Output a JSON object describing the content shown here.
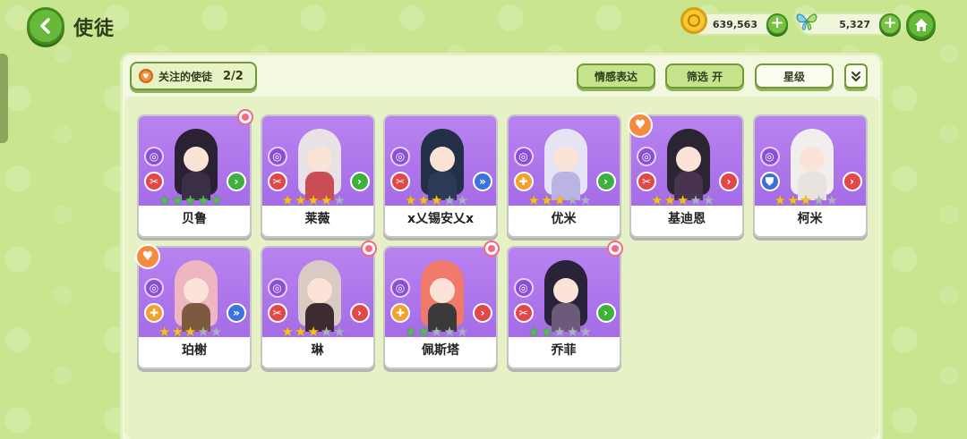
{
  "header": {
    "title": "使徒",
    "coin_amount": "639,563",
    "gem_amount": "5,327"
  },
  "toolbar": {
    "follow_label": "关注的使徒",
    "follow_count": "2/2",
    "emote_label": "情感表达",
    "filter_label": "筛选 开",
    "star_label": "星级"
  },
  "cards": [
    {
      "name": "贝鲁",
      "stars": 5,
      "star_color": "green",
      "hair": "#2a2233",
      "outfit": "#3b2f48",
      "role": "red",
      "element": "green",
      "badge": "flower"
    },
    {
      "name": "莱薇",
      "stars": 4,
      "star_color": "gold",
      "hair": "#e8e2e6",
      "outfit": "#c94d55",
      "role": "red",
      "element": "green",
      "badge": "none"
    },
    {
      "name": "x乂锡安乂x",
      "stars": 3,
      "star_color": "gold",
      "hair": "#233048",
      "outfit": "#2d3a57",
      "role": "red",
      "element": "blue",
      "badge": "none"
    },
    {
      "name": "优米",
      "stars": 3,
      "star_color": "gold",
      "hair": "#e6e3f4",
      "outfit": "#b9b4e4",
      "role": "orange",
      "element": "green",
      "badge": "none"
    },
    {
      "name": "基迪恩",
      "stars": 3,
      "star_color": "gold",
      "hair": "#2b2433",
      "outfit": "#4a3350",
      "role": "red",
      "element": "red",
      "badge": "heart"
    },
    {
      "name": "柯米",
      "stars": 3,
      "star_color": "gold",
      "hair": "#f1efee",
      "outfit": "#e9e3df",
      "role": "blue",
      "element": "red",
      "badge": "none"
    },
    {
      "name": "珀榭",
      "stars": 3,
      "star_color": "gold",
      "hair": "#eeb6c0",
      "outfit": "#7d5a3f",
      "role": "orange",
      "element": "blue",
      "badge": "heart"
    },
    {
      "name": "琳",
      "stars": 3,
      "star_color": "gold",
      "hair": "#d9cbc4",
      "outfit": "#3d2b30",
      "role": "red",
      "element": "red",
      "badge": "flower"
    },
    {
      "name": "佩斯塔",
      "stars": 2,
      "star_color": "green",
      "hair": "#f0796a",
      "outfit": "#3a3a3a",
      "role": "orange",
      "element": "red",
      "badge": "flower"
    },
    {
      "name": "乔菲",
      "stars": 2,
      "star_color": "green",
      "hair": "#2a2238",
      "outfit": "#6b5a7a",
      "role": "red",
      "element": "green",
      "badge": "flower"
    }
  ],
  "max_stars": 5
}
